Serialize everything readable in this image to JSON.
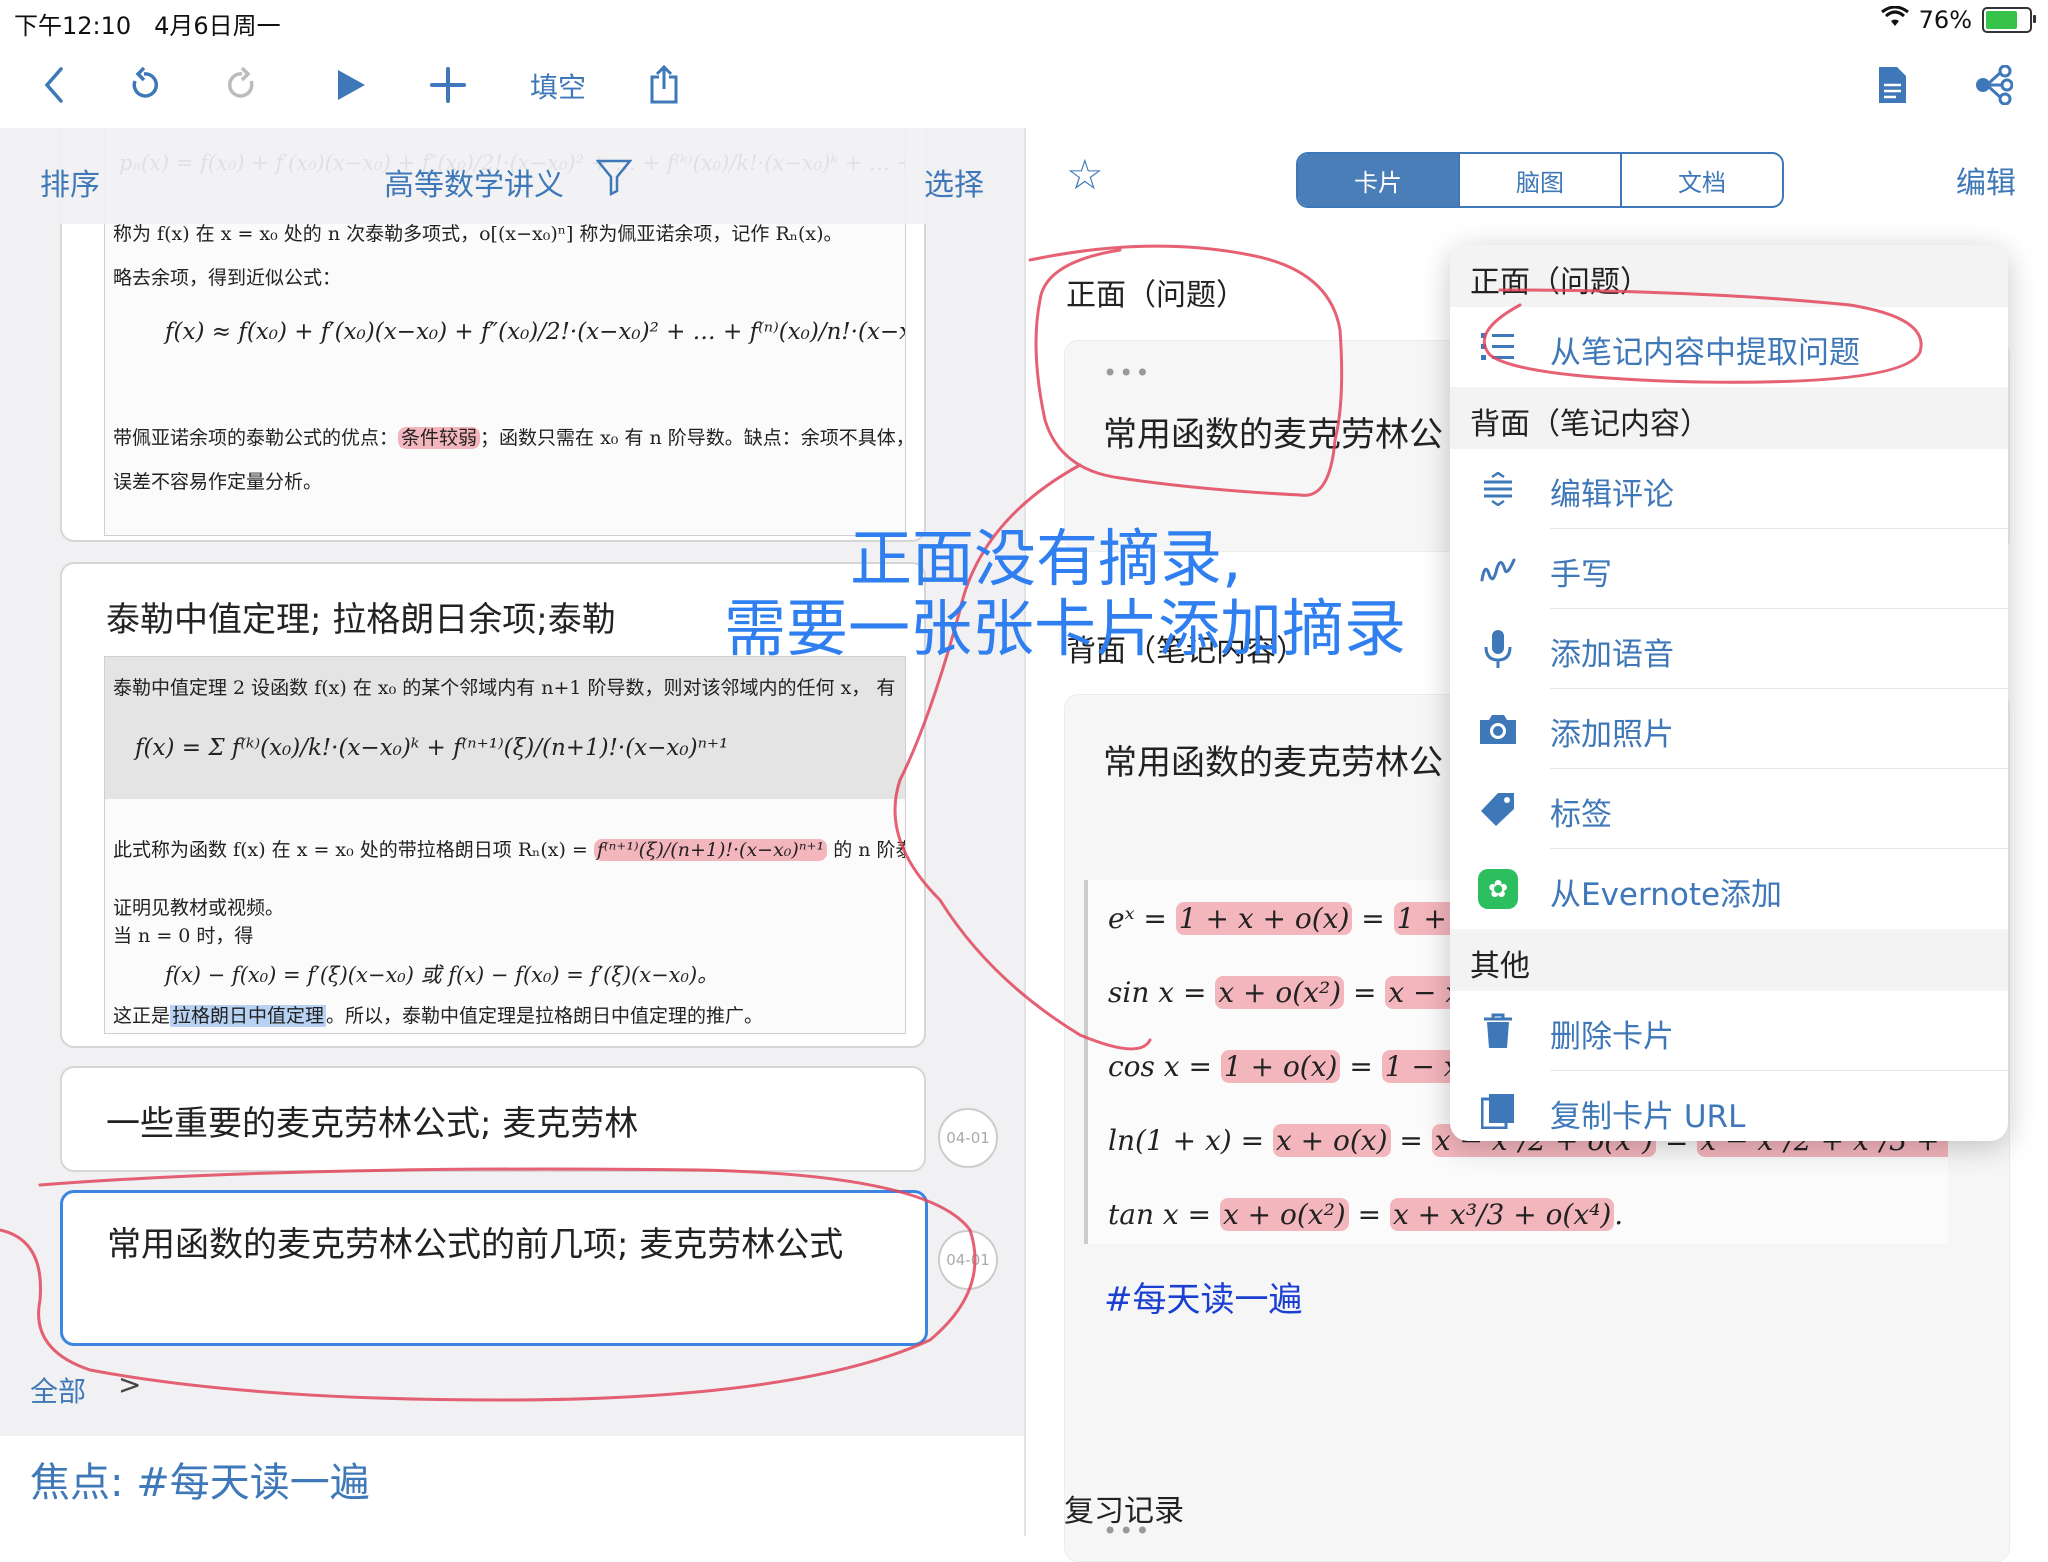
{
  "status": {
    "time": "下午12:10",
    "date": "4月6日周一",
    "battery": "76%"
  },
  "toolbar": {
    "fill_blank": "填空"
  },
  "left": {
    "sort": "排序",
    "notebook_title": "高等数学讲义",
    "select": "选择",
    "card1": {
      "line1": "称为 f(x) 在 x = x₀ 处的 n 次泰勒多项式，o[(x−x₀)ⁿ] 称为佩亚诺余项，记作 Rₙ(x)。",
      "line2": "略去余项，得到近似公式：",
      "line3a": "带佩亚诺余项的泰勒公式的优点：",
      "line3b": "条件较弱",
      "line3c": "；函数只需在 x₀ 有 n 阶导数。缺点：余项不具体，",
      "line4": "误差不容易作定量分析。"
    },
    "card2": {
      "title": "泰勒中值定理; 拉格朗日余项;泰勒",
      "line1": "泰勒中值定理 2  设函数 f(x) 在 x₀ 的某个邻域内有 n+1 阶导数，则对该邻域内的任何 x， 有",
      "line2": "此式称为函数 f(x) 在 x = x₀ 处的带拉格朗日项 Rₙ(x) =",
      "line2b": "的 n 阶泰勒公式。",
      "line3": "证明见教材或视频。",
      "line4": "当 n = 0 时，得",
      "line5a": "这正是",
      "line5b": "拉格朗日中值定理",
      "line5c": "。所以，泰勒中值定理是拉格朗日中值定理的推广。"
    },
    "card3": {
      "title": "一些重要的麦克劳林公式; 麦克劳林",
      "date": "04-01"
    },
    "card4": {
      "title": "常用函数的麦克劳林公式的前几项; 麦克劳林公式",
      "date": "04-01"
    },
    "all": "全部",
    "chevron": ">",
    "focus": "焦点:  #每天读一遍"
  },
  "right": {
    "tabs": [
      "卡片",
      "脑图",
      "文档"
    ],
    "edit": "编辑",
    "front_label": "正面（问题）",
    "front_text": "常用函数的麦克劳林公",
    "back_label": "背面（笔记内容）",
    "back_text": "常用函数的麦克劳林公",
    "dots": "•••",
    "tag": "#每天读一遍",
    "review": "复习记录"
  },
  "menu": {
    "sec_front": "正面（问题）",
    "extract": "从笔记内容中提取问题",
    "sec_back": "背面（笔记内容）",
    "items": [
      "编辑评论",
      "手写",
      "添加语音",
      "添加照片",
      "标签",
      "从Evernote添加"
    ],
    "sec_other": "其他",
    "delete": "删除卡片",
    "copy_url": "复制卡片 URL"
  },
  "annotation": {
    "line1": "正面没有摘录,",
    "line2": "需要一张张卡片添加摘录"
  },
  "colors": {
    "accent": "#3f78b8",
    "annotation_blue": "#2f7ff0",
    "annotation_red": "#e0455a",
    "highlight_pink": "#f4b6bd"
  }
}
